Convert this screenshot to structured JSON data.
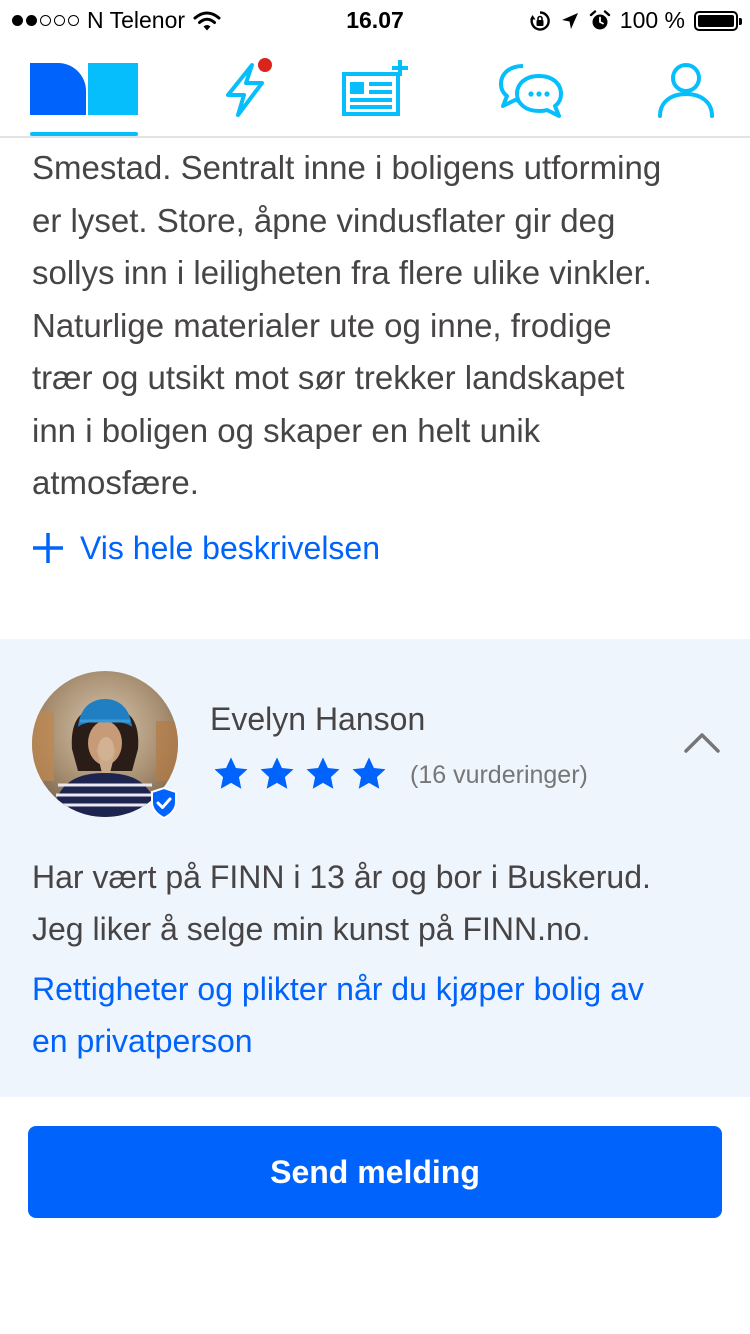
{
  "status_bar": {
    "carrier": "N Telenor",
    "time": "16.07",
    "battery": "100 %",
    "signal_bars_filled": 2,
    "signal_bars_total": 5
  },
  "nav": {
    "items": [
      {
        "icon": "finn-logo-icon",
        "active": true
      },
      {
        "icon": "lightning-icon",
        "badge": true
      },
      {
        "icon": "new-ad-icon"
      },
      {
        "icon": "messages-icon"
      },
      {
        "icon": "profile-icon"
      }
    ],
    "colors": {
      "accent": "#06befb",
      "brand_dark": "#0063fb",
      "badge": "#d9251c"
    }
  },
  "description": {
    "lines": [
      "Smestad. Sentralt inne i boligens utforming",
      "er lyset. Store, åpne vindusflater gir deg",
      "sollys inn i leiligheten fra flere ulike vinkler.",
      "Naturlige materialer ute og inne, frodige",
      "trær og utsikt mot sør trekker landskapet",
      "inn i boligen og skaper en helt unik",
      "atmosfære."
    ],
    "show_more": "Vis hele beskrivelsen"
  },
  "seller": {
    "name": "Evelyn Hanson",
    "rating_stars": 4,
    "rating_count": "(16 vurderinger)",
    "bio_lines": [
      "Har vært på FINN i 13 år og bor i Buskerud.",
      "Jeg liker å selge min kunst på FINN.no."
    ],
    "rights_link_lines": [
      "Rettigheter og plikter når du kjøper bolig av",
      "en privatperson"
    ]
  },
  "action": {
    "send_label": "Send melding"
  }
}
